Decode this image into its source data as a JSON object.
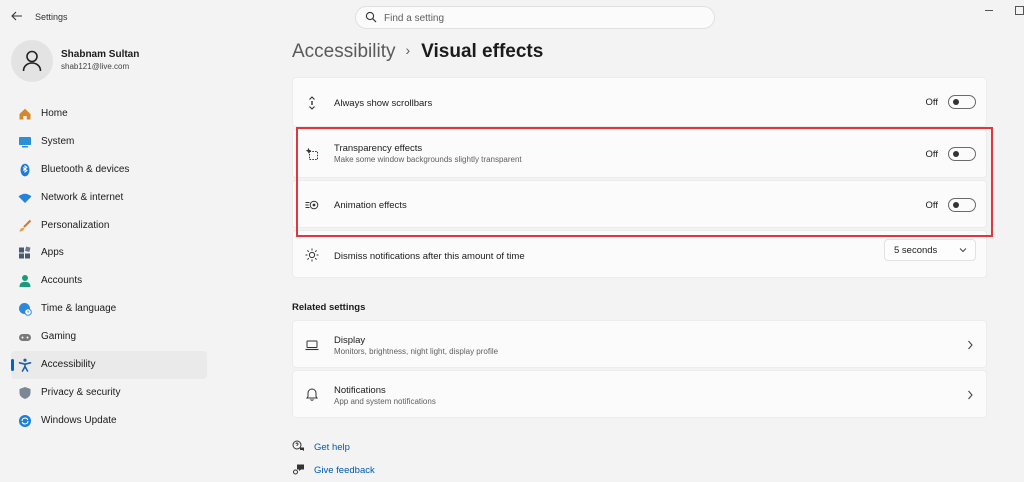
{
  "window": {
    "title": "Settings"
  },
  "search": {
    "placeholder": "Find a setting"
  },
  "user": {
    "name": "Shabnam Sultan",
    "email": "shab121@live.com"
  },
  "sidebar": {
    "items": [
      {
        "label": "Home",
        "icon": "home-icon",
        "color": "#d8862b"
      },
      {
        "label": "System",
        "icon": "monitor-icon",
        "color": "#2b8fd8"
      },
      {
        "label": "Bluetooth & devices",
        "icon": "bluetooth-icon",
        "color": "#1f7ad6"
      },
      {
        "label": "Network & internet",
        "icon": "wifi-icon",
        "color": "#2582d8"
      },
      {
        "label": "Personalization",
        "icon": "brush-icon",
        "color": "#d5762e"
      },
      {
        "label": "Apps",
        "icon": "apps-icon",
        "color": "#4a5a70"
      },
      {
        "label": "Accounts",
        "icon": "person-icon",
        "color": "#1c9a7b"
      },
      {
        "label": "Time & language",
        "icon": "globe-clock-icon",
        "color": "#2a8ad8"
      },
      {
        "label": "Gaming",
        "icon": "gamepad-icon",
        "color": "#7a7a7a"
      },
      {
        "label": "Accessibility",
        "icon": "accessibility-icon",
        "color": "#1b5fb3",
        "active": true
      },
      {
        "label": "Privacy & security",
        "icon": "shield-icon",
        "color": "#7a8795"
      },
      {
        "label": "Windows Update",
        "icon": "update-icon",
        "color": "#1c7fd6"
      }
    ]
  },
  "breadcrumb": {
    "parent": "Accessibility",
    "separator": "›",
    "current": "Visual effects"
  },
  "settings": {
    "scrollbars": {
      "title": "Always show scrollbars",
      "state": "Off"
    },
    "transparency": {
      "title": "Transparency effects",
      "subtitle": "Make some window backgrounds slightly transparent",
      "state": "Off"
    },
    "animation": {
      "title": "Animation effects",
      "state": "Off"
    },
    "notifications_timeout": {
      "title": "Dismiss notifications after this amount of time",
      "value": "5 seconds"
    }
  },
  "related": {
    "heading": "Related settings",
    "display": {
      "title": "Display",
      "subtitle": "Monitors, brightness, night light, display profile"
    },
    "notifications": {
      "title": "Notifications",
      "subtitle": "App and system notifications"
    }
  },
  "links": {
    "help": "Get help",
    "feedback": "Give feedback"
  },
  "colors": {
    "accent": "#0067c0",
    "highlight_border": "#e0363d",
    "link": "#0059b3"
  }
}
